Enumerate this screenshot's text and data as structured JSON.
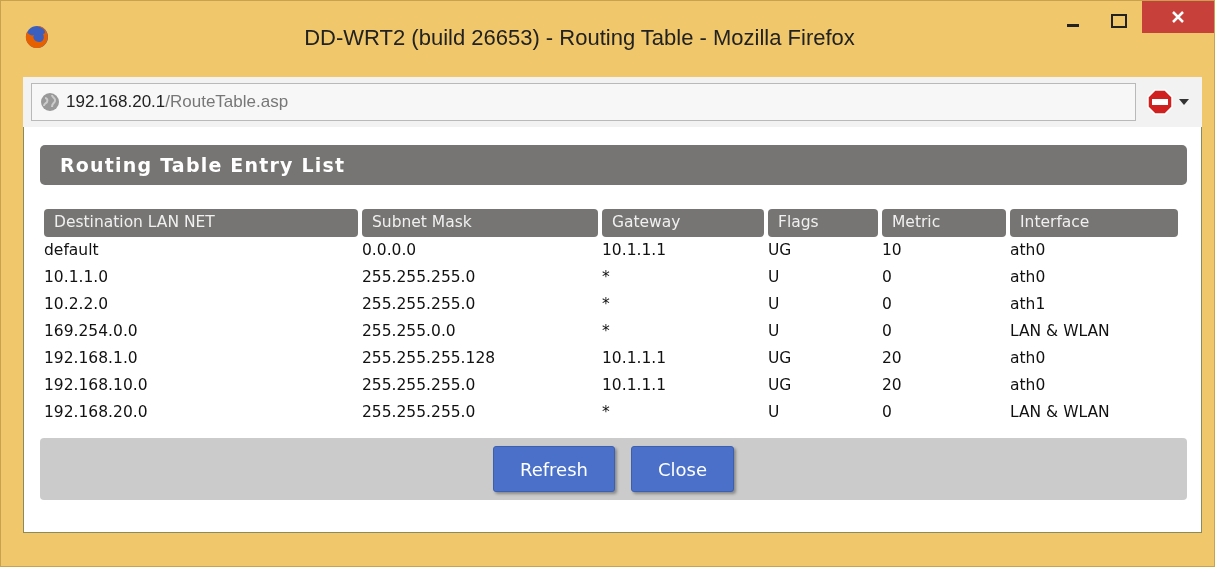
{
  "window": {
    "title": "DD-WRT2 (build 26653) - Routing Table - Mozilla Firefox"
  },
  "address_bar": {
    "host": "192.168.20.1",
    "path": "/RouteTable.asp"
  },
  "heading": "Routing Table Entry List",
  "table": {
    "columns": [
      "Destination LAN NET",
      "Subnet Mask",
      "Gateway",
      "Flags",
      "Metric",
      "Interface"
    ],
    "rows": [
      [
        "default",
        "0.0.0.0",
        "10.1.1.1",
        "UG",
        "10",
        "ath0"
      ],
      [
        "10.1.1.0",
        "255.255.255.0",
        "*",
        "U",
        "0",
        "ath0"
      ],
      [
        "10.2.2.0",
        "255.255.255.0",
        "*",
        "U",
        "0",
        "ath1"
      ],
      [
        "169.254.0.0",
        "255.255.0.0",
        "*",
        "U",
        "0",
        "LAN & WLAN"
      ],
      [
        "192.168.1.0",
        "255.255.255.128",
        "10.1.1.1",
        "UG",
        "20",
        "ath0"
      ],
      [
        "192.168.10.0",
        "255.255.255.0",
        "10.1.1.1",
        "UG",
        "20",
        "ath0"
      ],
      [
        "192.168.20.0",
        "255.255.255.0",
        "*",
        "U",
        "0",
        "LAN & WLAN"
      ]
    ]
  },
  "buttons": [
    "Refresh",
    "Close"
  ]
}
